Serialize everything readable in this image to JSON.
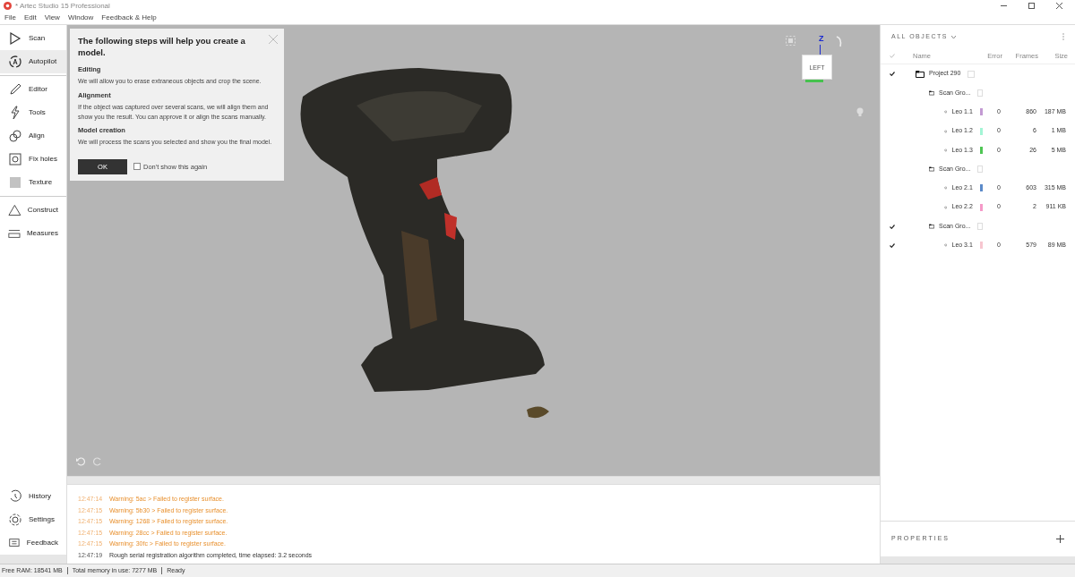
{
  "window": {
    "title": "* Artec Studio 15 Professional"
  },
  "menu": [
    "File",
    "Edit",
    "View",
    "Window",
    "Feedback & Help"
  ],
  "sidebar": {
    "groups": [
      [
        {
          "label": "Scan",
          "selected": false
        },
        {
          "label": "Autopilot",
          "selected": true
        }
      ],
      [
        {
          "label": "Editor",
          "selected": false
        },
        {
          "label": "Tools",
          "selected": false
        },
        {
          "label": "Align",
          "selected": false
        },
        {
          "label": "Fix holes",
          "selected": false
        },
        {
          "label": "Texture",
          "selected": false
        }
      ],
      [
        {
          "label": "Construct",
          "selected": false
        },
        {
          "label": "Measures",
          "selected": false
        }
      ]
    ],
    "bottom": [
      {
        "label": "History"
      },
      {
        "label": "Settings"
      },
      {
        "label": "Feedback"
      }
    ]
  },
  "dialog": {
    "title": "The following steps will help you create a model.",
    "sections": [
      {
        "heading": "Editing",
        "text": "We will allow you to erase extraneous objects and crop the scene."
      },
      {
        "heading": "Alignment",
        "text": "If the object was captured over several scans, we will align them and show you the result. You can approve it or align the scans manually."
      },
      {
        "heading": "Model creation",
        "text": "We will process the scans you selected and show you the final model."
      }
    ],
    "ok": "OK",
    "dont_show": {
      "label": "Don't show this again",
      "checked": false
    }
  },
  "view_cube": {
    "face": "LEFT",
    "axis": "Z"
  },
  "log": [
    {
      "time": "12:47:14",
      "text": "Warning: 5ac > Failed to register surface.",
      "kind": "warning"
    },
    {
      "time": "12:47:15",
      "text": "Warning: 5b30 > Failed to register surface.",
      "kind": "warning"
    },
    {
      "time": "12:47:15",
      "text": "Warning: 1268 > Failed to register surface.",
      "kind": "warning"
    },
    {
      "time": "12:47:15",
      "text": "Warning: 28cc > Failed to register surface.",
      "kind": "warning"
    },
    {
      "time": "12:47:15",
      "text": "Warning: 30fc > Failed to register surface.",
      "kind": "warning"
    },
    {
      "time": "12:47:19",
      "text": "Rough serial registration algorithm completed, time elapsed: 3.2 seconds",
      "kind": "info"
    }
  ],
  "objects": {
    "header": "ALL OBJECTS",
    "columns": [
      "Name",
      "Error",
      "Frames",
      "Size"
    ],
    "tree": [
      {
        "name": "Project 290",
        "kind": "folder",
        "checked": true,
        "children": [
          {
            "name": "Scan Gro...",
            "kind": "folder",
            "checked": false,
            "children": [
              {
                "name": "Leo 1.1",
                "kind": "scan",
                "checked": false,
                "color": "#c39bd3",
                "error": "0",
                "frames": "860",
                "size": "187 MB"
              },
              {
                "name": "Leo 1.2",
                "kind": "scan",
                "checked": false,
                "color": "#a3f5d5",
                "error": "0",
                "frames": "6",
                "size": "1 MB"
              },
              {
                "name": "Leo 1.3",
                "kind": "scan",
                "checked": false,
                "color": "#4fc654",
                "error": "0",
                "frames": "26",
                "size": "5 MB"
              }
            ]
          },
          {
            "name": "Scan Gro...",
            "kind": "folder",
            "checked": false,
            "children": [
              {
                "name": "Leo 2.1",
                "kind": "scan",
                "checked": false,
                "color": "#5b8ac9",
                "error": "0",
                "frames": "603",
                "size": "315 MB"
              },
              {
                "name": "Leo 2.2",
                "kind": "scan",
                "checked": false,
                "color": "#f59ac8",
                "error": "0",
                "frames": "2",
                "size": "911 KB"
              }
            ]
          },
          {
            "name": "Scan Gro...",
            "kind": "folder",
            "checked": true,
            "children": [
              {
                "name": "Leo 3.1",
                "kind": "scan",
                "checked": true,
                "color": "#f7c6d0",
                "error": "0",
                "frames": "579",
                "size": "89 MB"
              }
            ]
          }
        ]
      }
    ]
  },
  "properties": {
    "header": "PROPERTIES"
  },
  "status_bar": [
    "Free RAM: 18541 MB",
    "Total memory in use: 7277 MB",
    "Ready"
  ]
}
